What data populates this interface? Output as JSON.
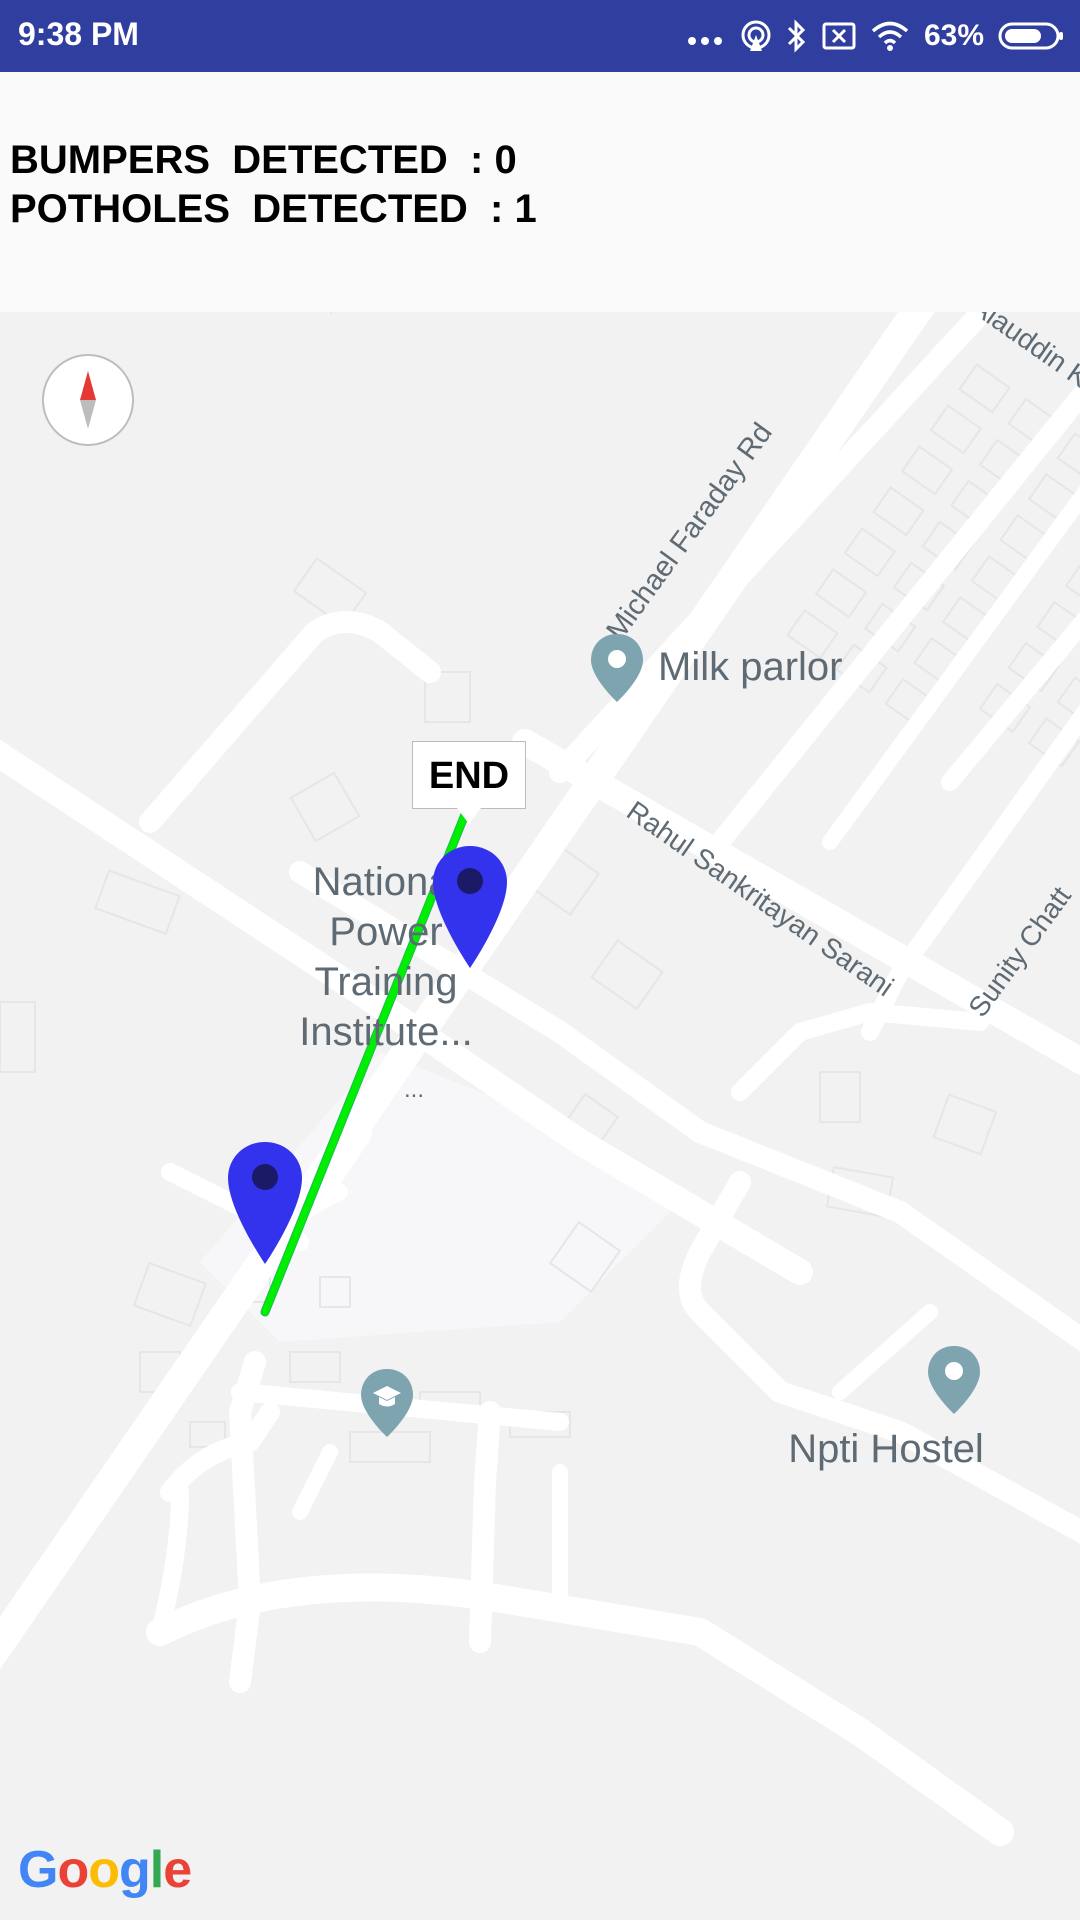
{
  "status_bar": {
    "time": "9:38 PM",
    "battery_percent": "63%",
    "icons": [
      "more-dots-icon",
      "hotspot-icon",
      "bluetooth-icon",
      "sim-x-icon",
      "wifi-icon",
      "battery-icon"
    ]
  },
  "counters": {
    "bumpers_label": "BUMPERS  DETECTED  : 0",
    "potholes_label": "POTHOLES  DETECTED  : 1"
  },
  "map": {
    "streets": {
      "michael_faraday": "Michael Faraday Rd",
      "rahul_sankrityayan": "Rahul Sankritayan Sarani",
      "sunity_chatterjee": "Sunity Chatt",
      "alauddin": "Alauddin K"
    },
    "places": {
      "milk_parlor": "Milk parlor",
      "npti_line1": "National",
      "npti_line2": "Power",
      "npti_line3": "Training",
      "npti_line4": "Institute...",
      "school_ellipsis": "...",
      "npti_hostel": "Npti Hostel"
    },
    "end_marker_label": "END",
    "route_color": "#00ee00",
    "marker_color": "#3333ee",
    "attribution": {
      "g1": "G",
      "o1": "o",
      "o2": "o",
      "g2": "g",
      "l": "l",
      "e": "e"
    }
  }
}
